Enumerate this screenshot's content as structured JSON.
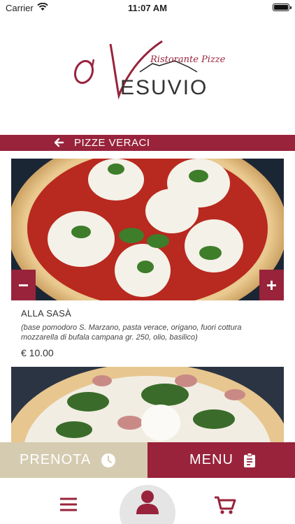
{
  "status_bar": {
    "carrier": "Carrier",
    "time": "11:07 AM"
  },
  "brand": {
    "logo_text_main": "ESUVIO",
    "logo_text_prefix": "O'",
    "logo_subtitle": "Ristorante Pizzeria"
  },
  "section": {
    "title": "PIZZE VERACI"
  },
  "item": {
    "name": "ALLA SASÀ",
    "description": "(base pomodoro S. Marzano, pasta verace, origano, fuori cottura mozzarella di bufala campana gr. 250, olio, basilico)",
    "price": "€ 10.00",
    "minus_label": "−",
    "plus_label": "+"
  },
  "actions": {
    "prenota_label": "PRENOTA",
    "menu_label": "MENU"
  },
  "colors": {
    "accent": "#98233b",
    "prenota_bg": "#d5cbb0"
  },
  "icons": [
    "wifi-icon",
    "battery-icon",
    "back-arrow-icon",
    "clock-icon",
    "clipboard-icon",
    "hamburger-icon",
    "user-icon",
    "cart-icon"
  ]
}
